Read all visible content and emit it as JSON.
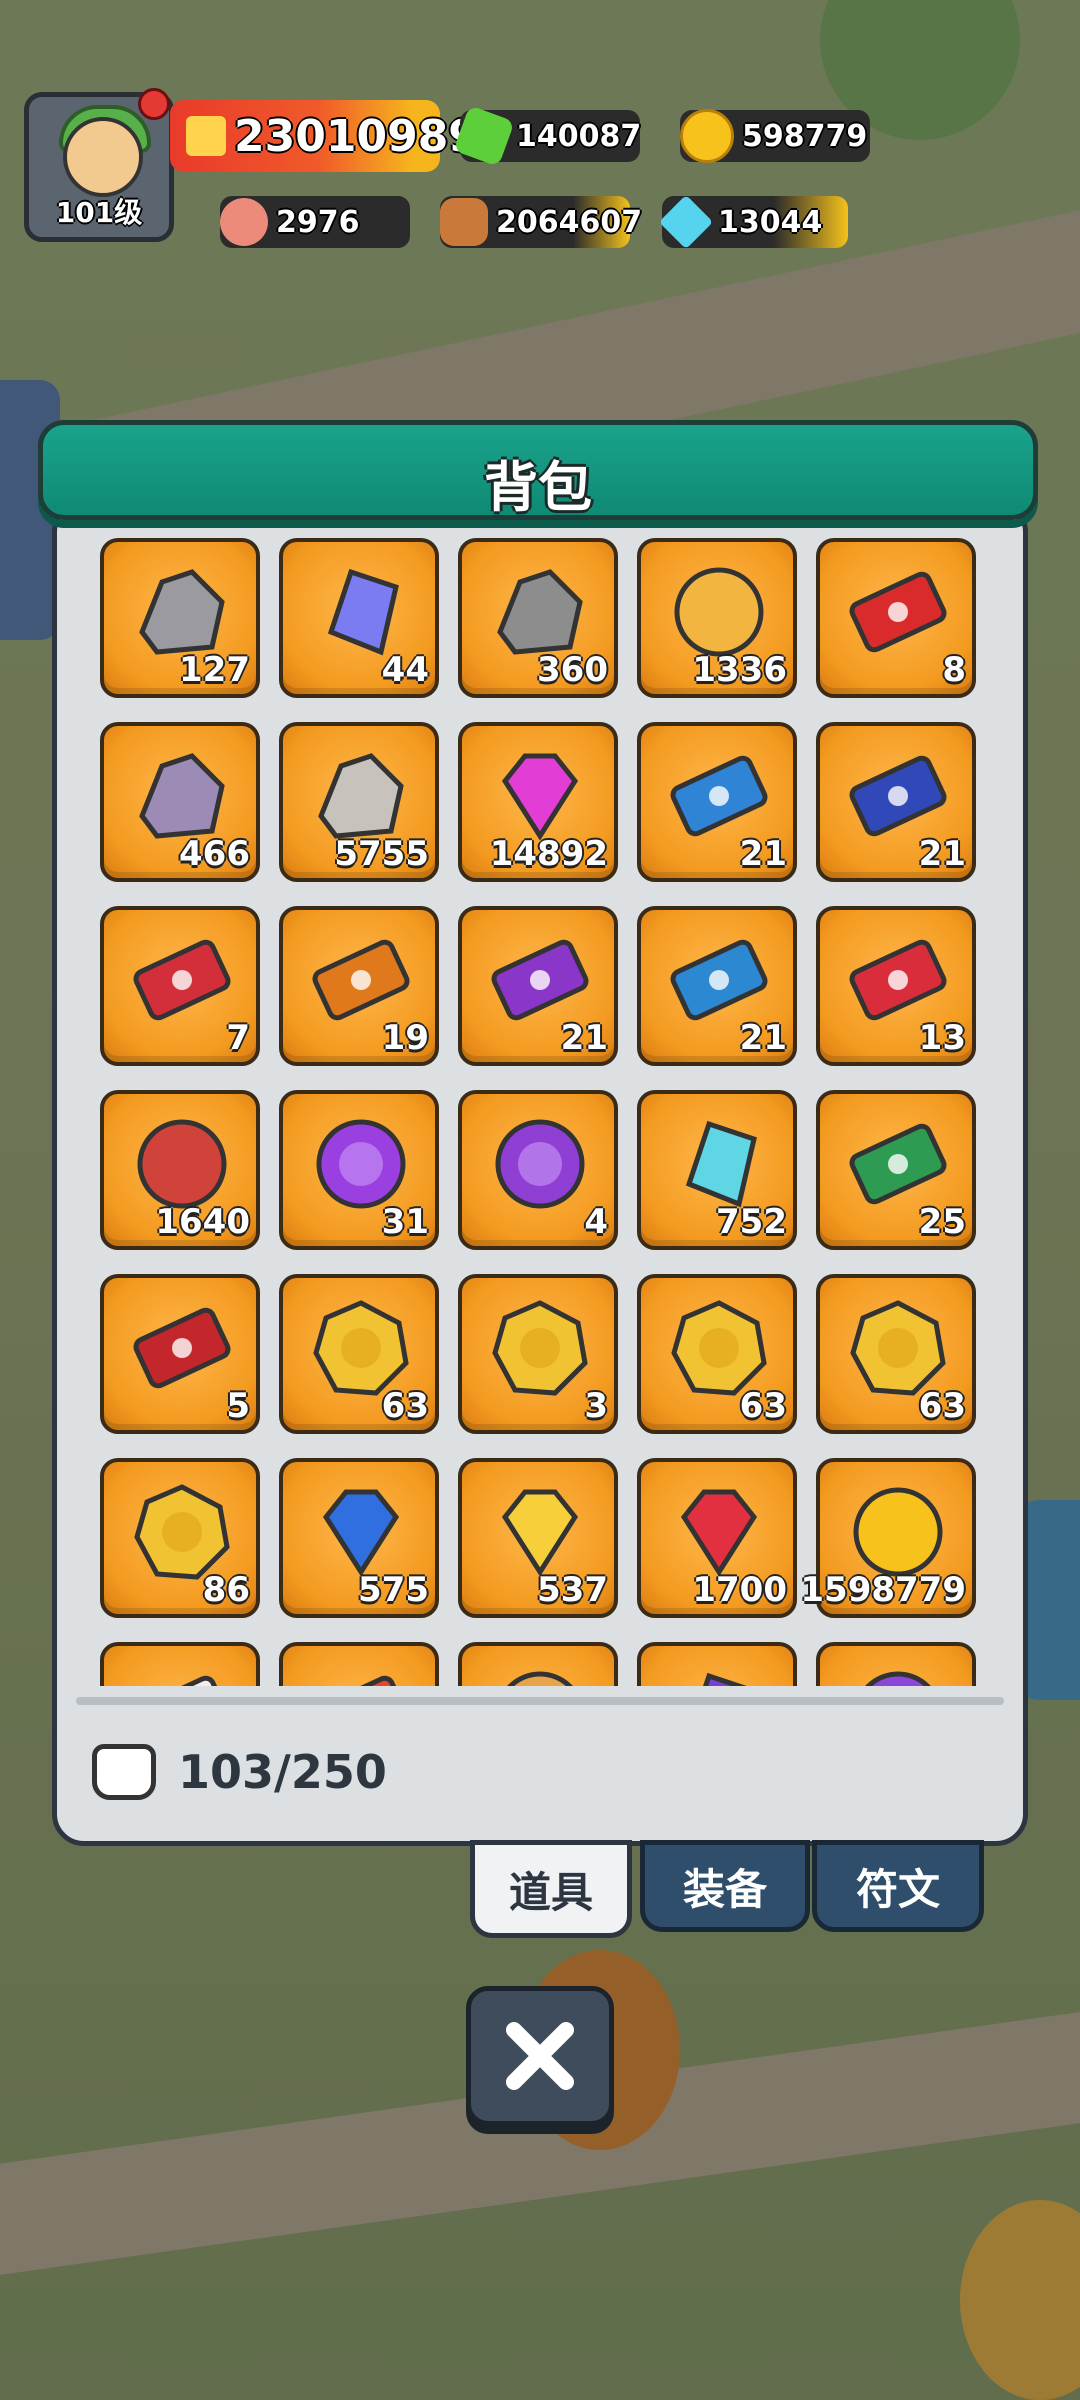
{
  "hud": {
    "player_level": "101级",
    "combat_power": "23010989",
    "green_gems": "140087",
    "gold": "598779",
    "meat": "2976",
    "wood": "2064607",
    "crystal": "13044"
  },
  "panel": {
    "title": "背包",
    "capacity": "103/250"
  },
  "items": [
    {
      "icon": "stone-icon",
      "count": "127",
      "color": "#9a9aa0"
    },
    {
      "icon": "blue-crystal-icon",
      "count": "44",
      "color": "#7b7cf2"
    },
    {
      "icon": "hammer-icon",
      "count": "360",
      "color": "#8d8d8d"
    },
    {
      "icon": "winged-medal-icon",
      "count": "1336",
      "color": "#f2b640"
    },
    {
      "icon": "red-ticket-icon",
      "count": "8",
      "color": "#d92b2b"
    },
    {
      "icon": "purple-rune-stone-icon",
      "count": "466",
      "color": "#9c8bb5"
    },
    {
      "icon": "red-rune-stone-icon",
      "count": "5755",
      "color": "#c8c2bc"
    },
    {
      "icon": "pink-diamond-icon",
      "count": "14892",
      "color": "#e23ed6"
    },
    {
      "icon": "blue-ticket-icon",
      "count": "21",
      "color": "#2f84d6"
    },
    {
      "icon": "blue-ticket-icon",
      "count": "21",
      "color": "#3149b8"
    },
    {
      "icon": "fire-ticket-icon",
      "count": "7",
      "color": "#d32f3a"
    },
    {
      "icon": "lightning-ticket-icon",
      "count": "19",
      "color": "#e0781c"
    },
    {
      "icon": "potion-ticket-icon",
      "count": "21",
      "color": "#8a36c9"
    },
    {
      "icon": "ice-ticket-icon",
      "count": "21",
      "color": "#2b88d1"
    },
    {
      "icon": "flame-ticket-icon",
      "count": "13",
      "color": "#d92d3c"
    },
    {
      "icon": "meat-icon",
      "count": "1640",
      "color": "#d0433a"
    },
    {
      "icon": "sword-orb-icon",
      "count": "31",
      "color": "#9a3fe0"
    },
    {
      "icon": "helmet-orb-icon",
      "count": "4",
      "color": "#8f3fd4"
    },
    {
      "icon": "ice-crystal-icon",
      "count": "752",
      "color": "#5fd6e4"
    },
    {
      "icon": "green-ticket-icon",
      "count": "25",
      "color": "#2e9b52"
    },
    {
      "icon": "red-scroll-icon",
      "count": "5",
      "color": "#c3262b"
    },
    {
      "icon": "gold-coin-wing-icon",
      "count": "63",
      "color": "#f1c232"
    },
    {
      "icon": "gold-coin-sword-icon",
      "count": "3",
      "color": "#f1c232"
    },
    {
      "icon": "gold-coin-bow-icon",
      "count": "63",
      "color": "#f1c232"
    },
    {
      "icon": "gold-coin-shield-icon",
      "count": "63",
      "color": "#f1c232"
    },
    {
      "icon": "gold-coin-rune-icon",
      "count": "86",
      "color": "#f1c232"
    },
    {
      "icon": "blue-gem-icon",
      "count": "575",
      "color": "#2f6fe0"
    },
    {
      "icon": "yellow-gem-icon",
      "count": "537",
      "color": "#f6cf3a"
    },
    {
      "icon": "red-gem-icon",
      "count": "1700",
      "color": "#e23040"
    },
    {
      "icon": "gold-coin-icon",
      "count": "1598779",
      "color": "#f8c21c"
    },
    {
      "icon": "scroll-icon",
      "count": "",
      "color": "#f3efe6"
    },
    {
      "icon": "ribbon-icon",
      "count": "",
      "color": "#e3452c"
    },
    {
      "icon": "bread-icon",
      "count": "",
      "color": "#e7a44a"
    },
    {
      "icon": "purple-crystal-icon",
      "count": "",
      "color": "#7b3fd0"
    },
    {
      "icon": "purple-arrow-icon",
      "count": "",
      "color": "#8c47d8"
    }
  ],
  "tabs": [
    {
      "label": "道具",
      "active": true
    },
    {
      "label": "装备",
      "active": false
    },
    {
      "label": "符文",
      "active": false
    }
  ],
  "close_icon": "close-icon"
}
